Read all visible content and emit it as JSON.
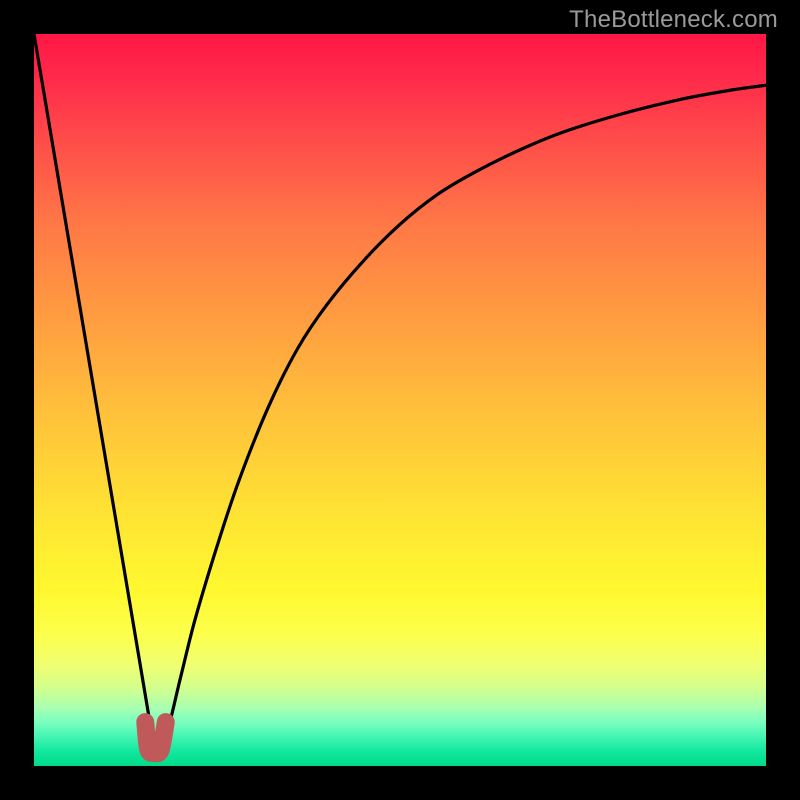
{
  "watermark": "TheBottleneck.com",
  "chart_data": {
    "type": "line",
    "title": "",
    "xlabel": "",
    "ylabel": "",
    "xlim": [
      0,
      100
    ],
    "ylim": [
      0,
      100
    ],
    "grid": false,
    "legend": false,
    "series": [
      {
        "name": "left-descent",
        "x": [
          0,
          16.5
        ],
        "y": [
          100,
          2
        ]
      },
      {
        "name": "right-curve",
        "x": [
          16.5,
          18,
          20,
          22,
          25,
          28,
          32,
          36,
          40,
          45,
          50,
          55,
          60,
          66,
          72,
          80,
          88,
          95,
          100
        ],
        "y": [
          2,
          4,
          12,
          20,
          30,
          39,
          49,
          57,
          63,
          69,
          74,
          78,
          81,
          84,
          86.5,
          89,
          91,
          92.3,
          93
        ]
      }
    ],
    "marker": {
      "name": "highlight-segment",
      "color": "#c05a5a",
      "x": [
        15.2,
        15.6,
        16.4,
        17.3,
        18.0
      ],
      "y": [
        6.0,
        2.3,
        1.8,
        2.2,
        6.0
      ]
    },
    "background": {
      "type": "vertical-gradient",
      "stops": [
        {
          "pos": 0.0,
          "color": "#ff1744"
        },
        {
          "pos": 0.4,
          "color": "#ffa83e"
        },
        {
          "pos": 0.7,
          "color": "#ffe833"
        },
        {
          "pos": 0.88,
          "color": "#e0ff80"
        },
        {
          "pos": 1.0,
          "color": "#00db88"
        }
      ]
    }
  }
}
